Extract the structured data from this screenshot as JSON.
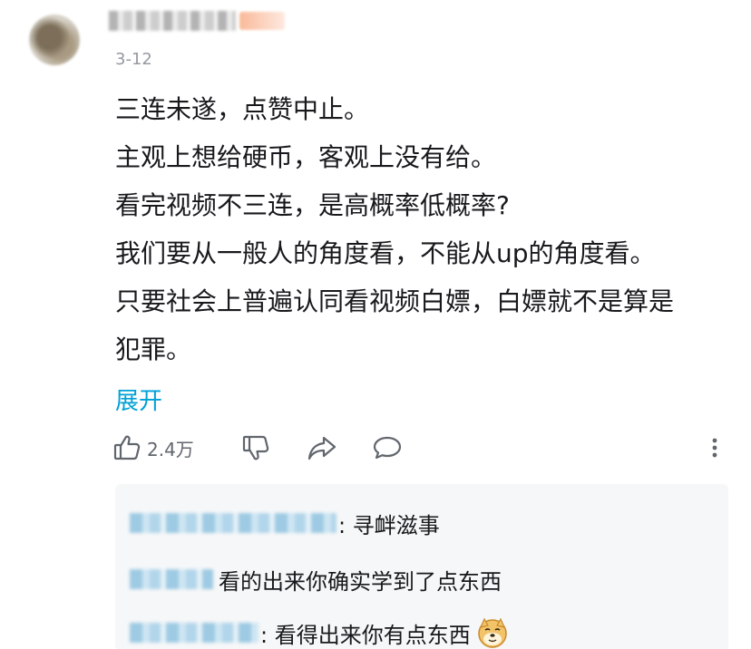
{
  "comment": {
    "date": "3-12",
    "lines": [
      "三连未遂，点赞中止。",
      "主观上想给硬币，客观上没有给。",
      "看完视频不三连，是高概率低概率?",
      "我们要从一般人的角度看，不能从up的角度看。",
      "只要社会上普遍认同看视频白嫖，白嫖就不是算是",
      "犯罪。"
    ],
    "expand_label": "展开",
    "like_count": "2.4万"
  },
  "icons": {
    "like": "thumb-up-icon",
    "dislike": "thumb-down-icon",
    "share": "share-icon",
    "reply": "comment-bubble-icon",
    "more": "more-vertical-icon",
    "emoji": "doge-emoji-icon"
  },
  "replies": [
    {
      "text": ": 寻衅滋事"
    },
    {
      "text": "看的出来你确实学到了点东西"
    },
    {
      "text": ": 看得出来你有点东西",
      "emoji": "doge"
    }
  ],
  "colors": {
    "accent": "#00a1d6",
    "secondary_text": "#9499a0",
    "reply_background": "#f6f7f8"
  }
}
